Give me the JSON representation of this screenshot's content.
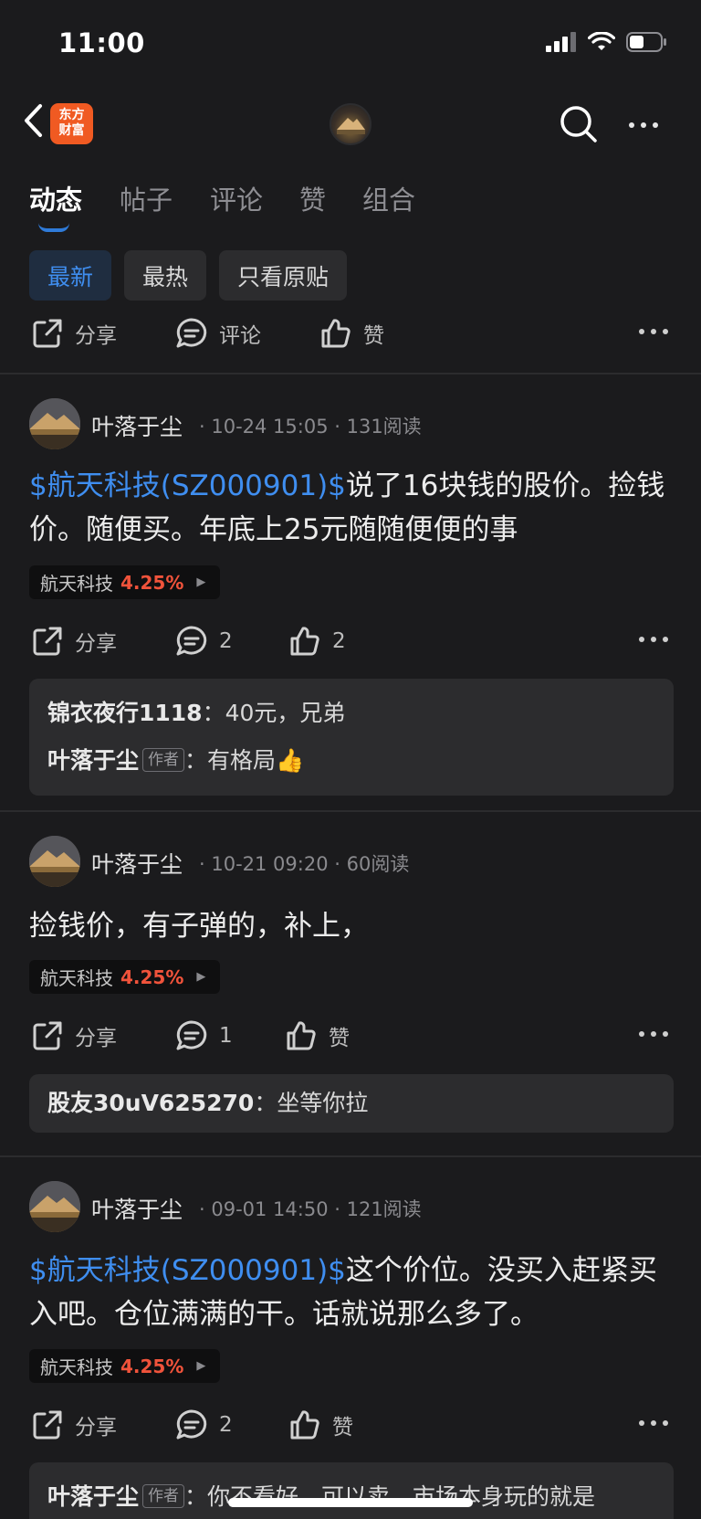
{
  "status": {
    "time": "11:00"
  },
  "nav": {
    "logo_text": "东方财富"
  },
  "tabs": [
    "动态",
    "帖子",
    "评论",
    "赞",
    "组合"
  ],
  "filters": [
    "最新",
    "最热",
    "只看原贴"
  ],
  "top_actions": {
    "share": "分享",
    "comment": "评论",
    "like": "赞"
  },
  "posts": [
    {
      "author": "叶落于尘",
      "meta": "· 10-24 15:05 · 131阅读",
      "stock_mention": "$航天科技(SZ000901)$",
      "text": "说了16块钱的股价。捡钱价。随便买。年底上25元随随便便的事",
      "tag": {
        "name": "航天科技",
        "change": "4.25%"
      },
      "actions": {
        "share": "分享",
        "comments": "2",
        "likes": "2"
      },
      "comments": [
        {
          "user": "锦衣夜行1118",
          "sep": "：",
          "text": "40元，兄弟",
          "is_author": false
        },
        {
          "user": "叶落于尘",
          "badge": "作者",
          "sep": "：",
          "text": "有格局👍",
          "is_author": true
        }
      ]
    },
    {
      "author": "叶落于尘",
      "meta": "· 10-21 09:20 · 60阅读",
      "stock_mention": "",
      "text": "捡钱价，有子弹的，补上，",
      "tag": {
        "name": "航天科技",
        "change": "4.25%"
      },
      "actions": {
        "share": "分享",
        "comments": "1",
        "likes": "赞"
      },
      "comments": [
        {
          "user": "股友30uV625270",
          "sep": "：",
          "text": "坐等你拉",
          "is_author": false
        }
      ]
    },
    {
      "author": "叶落于尘",
      "meta": "· 09-01 14:50 · 121阅读",
      "stock_mention": "$航天科技(SZ000901)$",
      "text": "这个价位。没买入赶紧买入吧。仓位满满的干。话就说那么多了。",
      "tag": {
        "name": "航天科技",
        "change": "4.25%"
      },
      "actions": {
        "share": "分享",
        "comments": "2",
        "likes": "赞"
      },
      "comments": [
        {
          "user": "叶落于尘",
          "badge": "作者",
          "sep": "：",
          "text": "你不看好，可以卖，市场本身玩的就是",
          "is_author": true
        }
      ]
    }
  ]
}
